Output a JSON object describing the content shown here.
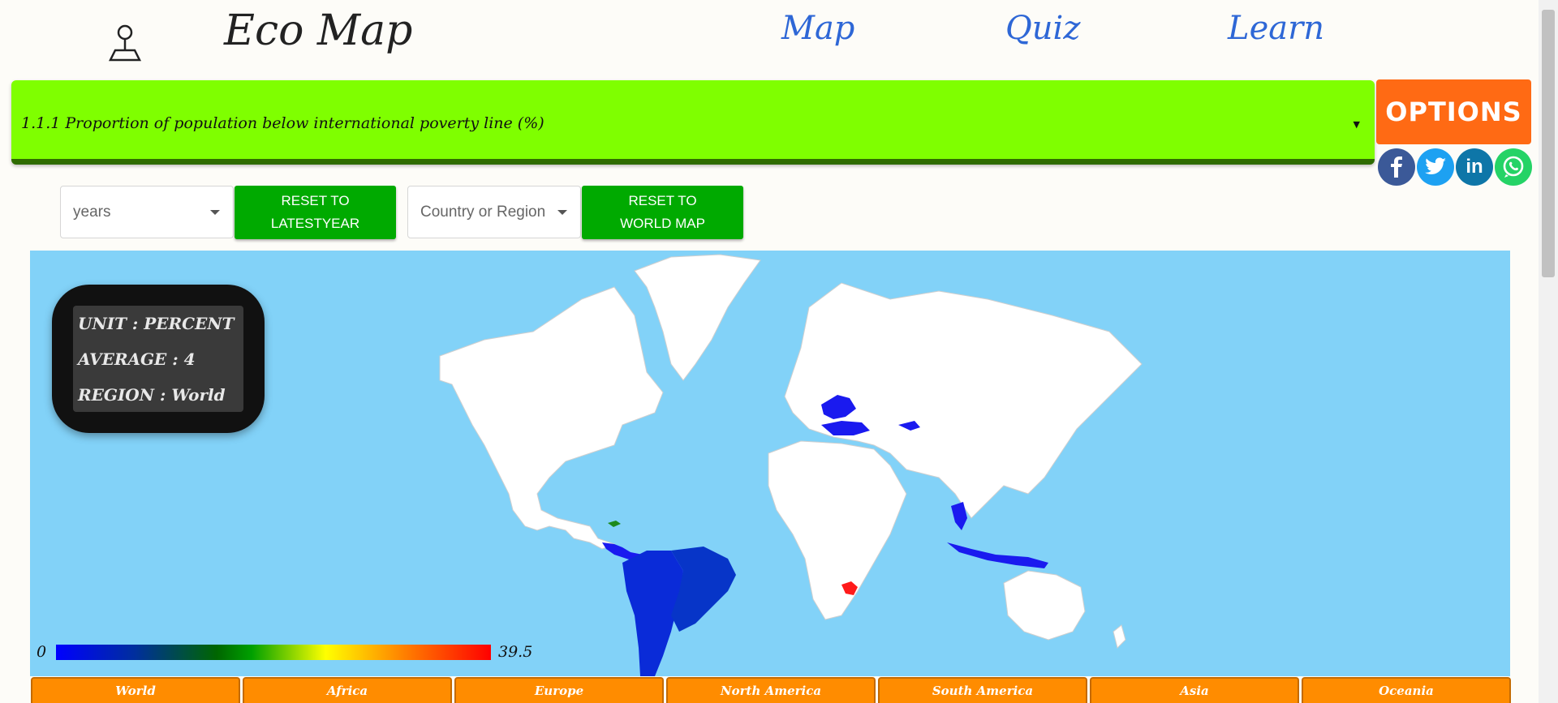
{
  "app": {
    "brand": "Eco Map"
  },
  "nav": {
    "map": "Map",
    "quiz": "Quiz",
    "learn": "Learn"
  },
  "indicator": {
    "label": "1.1.1 Proportion of population below international poverty line (%)"
  },
  "options_label": "OPTIONS",
  "social": [
    "facebook-icon",
    "twitter-icon",
    "linkedin-icon",
    "whatsapp-icon"
  ],
  "controls": {
    "years_placeholder": "years",
    "reset_year": "RESET TO\nLATESTYEAR",
    "region_placeholder": "Country or Region",
    "reset_map": "RESET TO\nWORLD MAP"
  },
  "info": {
    "unit": "UNIT        : PERCENT",
    "average": "AVERAGE : 4",
    "region": "REGION    : World"
  },
  "legend": {
    "min": "0",
    "max": "39.5"
  },
  "regions": [
    "World",
    "Africa",
    "Europe",
    "North America",
    "South America",
    "Asia",
    "Oceania"
  ],
  "colors": {
    "ocean": "#82d2f8",
    "indicator_bg": "#7fff00",
    "options_bg": "#ff6a14",
    "button_green": "#00aa00",
    "tab_orange": "#ff8c00",
    "nav_blue": "#2e67d6"
  }
}
